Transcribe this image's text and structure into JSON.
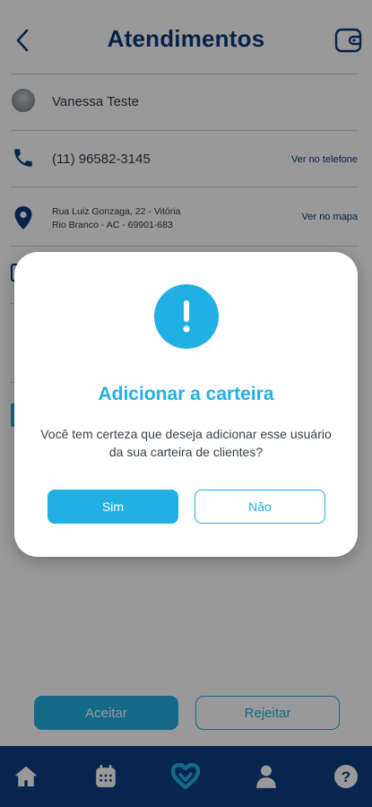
{
  "header": {
    "title": "Atendimentos",
    "back_icon": "chevron-left-icon",
    "wallet_icon": "wallet-icon"
  },
  "contact": {
    "name": "Vanessa Teste",
    "phone": "(11) 96582-3145",
    "phone_link": "Ver no telefone",
    "address_line1": "Rua Luiz Gonzaga, 22 - Vitória",
    "address_line2": "Rio Branco - AC - 69901-683",
    "address_link": "Ver no mapa"
  },
  "actions": {
    "accept_label": "Aceitar",
    "reject_label": "Rejeitar"
  },
  "bottom_nav": {
    "items": [
      {
        "icon": "home-icon"
      },
      {
        "icon": "calendar-icon"
      },
      {
        "icon": "heart-handshake-icon"
      },
      {
        "icon": "user-icon"
      },
      {
        "icon": "help-icon"
      }
    ]
  },
  "dialog": {
    "icon": "alert-icon",
    "title": "Adicionar a carteira",
    "message": "Você tem certeza que deseja adicionar esse usuário da sua carteira de clientes?",
    "yes_label": "Sim",
    "no_label": "Não"
  },
  "colors": {
    "primary_dark": "#0e3a7a",
    "accent": "#21b0e3",
    "nav_bg": "#0e3f86"
  }
}
